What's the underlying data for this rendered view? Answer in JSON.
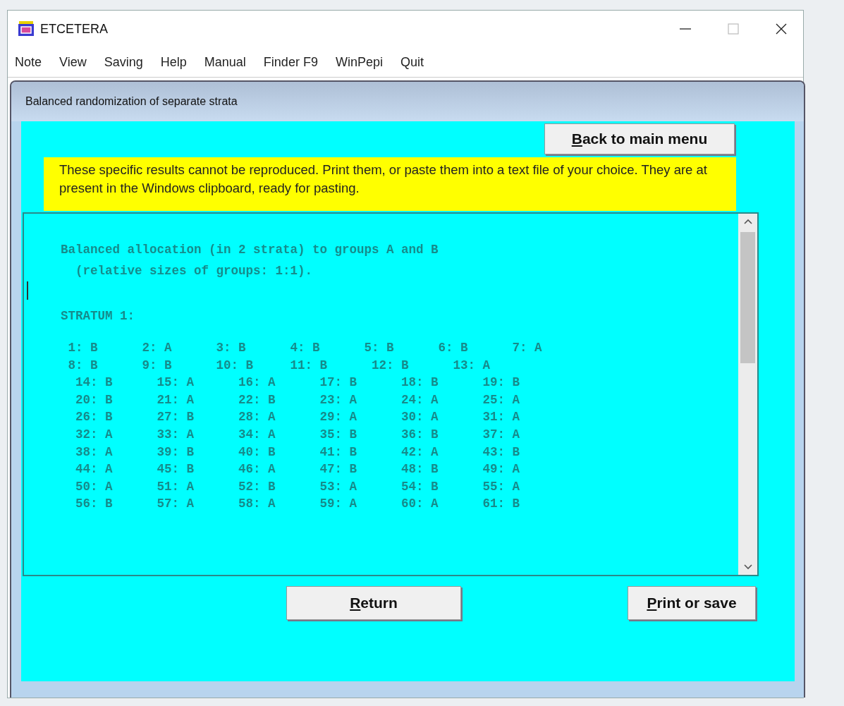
{
  "window": {
    "title": "ETCETERA"
  },
  "menu": [
    "Note",
    "View",
    "Saving",
    "Help",
    "Manual",
    "Finder F9",
    "WinPepi",
    "Quit"
  ],
  "dialog": {
    "title": "Balanced randomization of separate strata",
    "back_button": "Back to main menu",
    "notice": "These specific results cannot be reproduced.  Print them, or paste them into a text file of your choice.  They are at present in the Windows clipboard, ready for pasting.",
    "heading_lines": [
      "Balanced allocation (in 2 strata) to groups A and B",
      "  (relative sizes of groups: 1:1)."
    ],
    "stratum_label": "STRATUM 1:",
    "allocation_rows": [
      " 1: B      2: A      3: B      4: B      5: B      6: B      7: A",
      " 8: B      9: B      10: B     11: B      12: B      13: A",
      "  14: B      15: A      16: A      17: B      18: B      19: B",
      "  20: B      21: A      22: B      23: A      24: A      25: A",
      "  26: B      27: B      28: A      29: A      30: A      31: A",
      "  32: A      33: A      34: A      35: B      36: B      37: A",
      "  38: A      39: B      40: B      41: B      42: A      43: B",
      "  44: A      45: B      46: A      47: B      48: B      49: A",
      "  50: A      51: A      52: B      53: A      54: B      55: A",
      "  56: B      57: A      58: A      59: A      60: A      61: B"
    ],
    "buttons": [
      {
        "kind": "return",
        "label": "Return"
      },
      {
        "kind": "print",
        "label": "Print or save"
      }
    ]
  }
}
